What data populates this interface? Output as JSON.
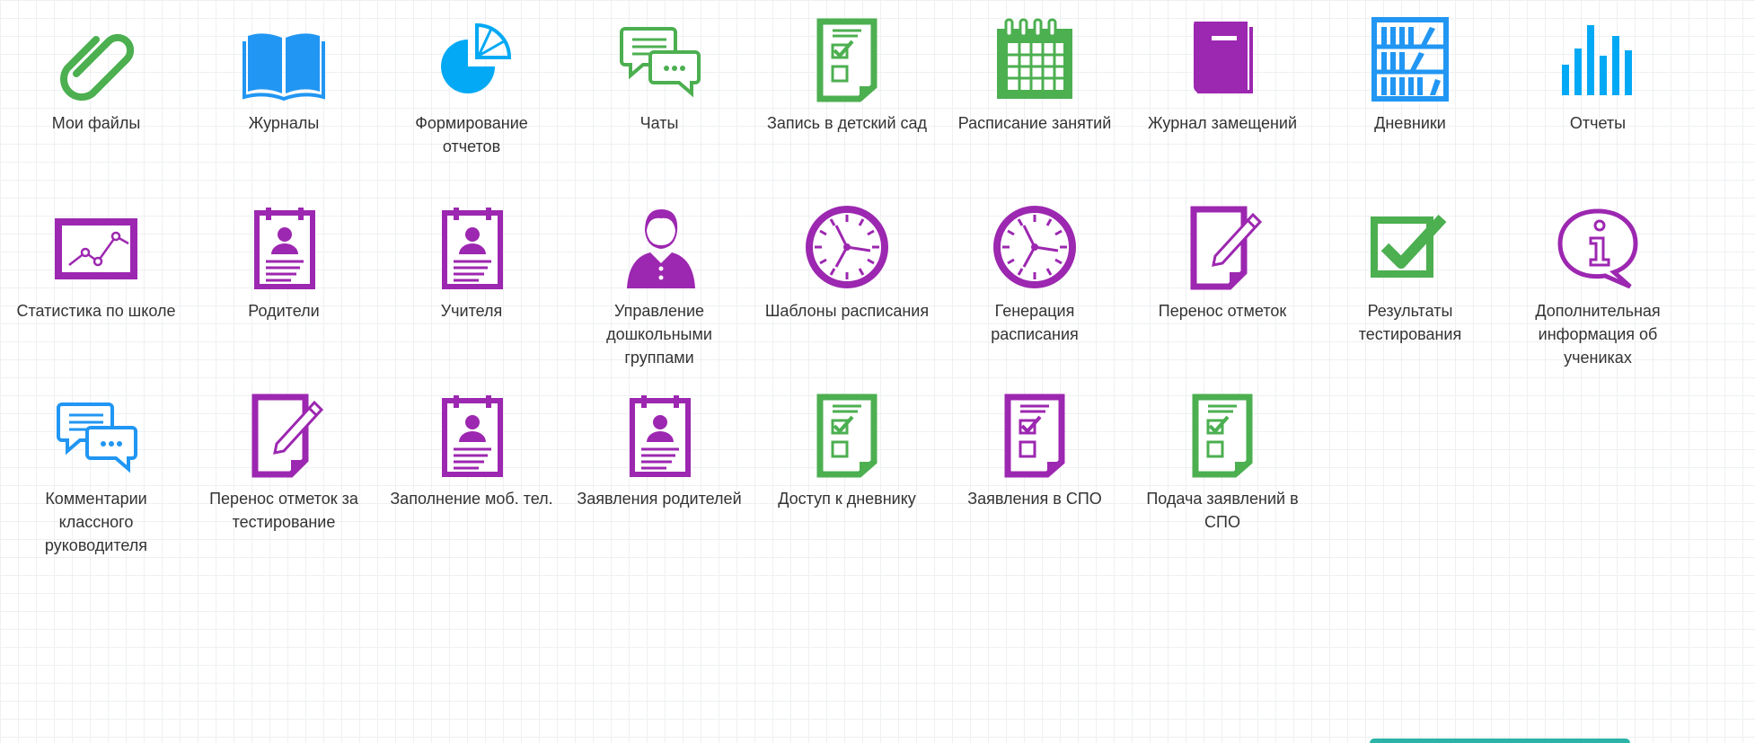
{
  "colors": {
    "green": "#4caf50",
    "blue": "#2196f3",
    "cyan": "#03a9f4",
    "purple": "#9c27b0",
    "label": "#333333"
  },
  "tiles": [
    {
      "id": "my-files",
      "label": "Мои файлы",
      "icon": "paperclip-icon",
      "color": "green"
    },
    {
      "id": "journals",
      "label": "Журналы",
      "icon": "open-book-icon",
      "color": "blue"
    },
    {
      "id": "reports-builder",
      "label": "Формирование отчетов",
      "icon": "pie-chart-icon",
      "color": "cyan"
    },
    {
      "id": "chats",
      "label": "Чаты",
      "icon": "chat-bubbles-icon",
      "color": "green"
    },
    {
      "id": "kindergarten-enrollment",
      "label": "Запись в детский сад",
      "icon": "checklist-document-icon",
      "color": "green"
    },
    {
      "id": "lesson-schedule",
      "label": "Расписание занятий",
      "icon": "calendar-icon",
      "color": "green"
    },
    {
      "id": "substitution-journal",
      "label": "Журнал замещений",
      "icon": "closed-book-icon",
      "color": "purple"
    },
    {
      "id": "diaries",
      "label": "Дневники",
      "icon": "bookshelf-icon",
      "color": "blue"
    },
    {
      "id": "reports",
      "label": "Отчеты",
      "icon": "bar-chart-icon",
      "color": "cyan"
    },
    {
      "id": "school-statistics",
      "label": "Статистика по школе",
      "icon": "line-chart-icon",
      "color": "purple"
    },
    {
      "id": "parents",
      "label": "Родители",
      "icon": "profile-card-icon",
      "color": "purple"
    },
    {
      "id": "teachers",
      "label": "Учителя",
      "icon": "profile-card-icon",
      "color": "purple"
    },
    {
      "id": "preschool-groups",
      "label": "Управление дошкольными группами",
      "icon": "user-icon",
      "color": "purple"
    },
    {
      "id": "schedule-templates",
      "label": "Шаблоны расписания",
      "icon": "clock-icon",
      "color": "purple"
    },
    {
      "id": "schedule-generation",
      "label": "Генерация расписания",
      "icon": "clock-icon",
      "color": "purple"
    },
    {
      "id": "grade-transfer",
      "label": "Перенос отметок",
      "icon": "document-pencil-icon",
      "color": "purple"
    },
    {
      "id": "test-results",
      "label": "Результаты тестирования",
      "icon": "checkbox-checked-icon",
      "color": "green"
    },
    {
      "id": "student-extra-info",
      "label": "Дополнительная информация об учениках",
      "icon": "info-bubble-icon",
      "color": "purple"
    },
    {
      "id": "class-teacher-comments",
      "label": "Комментарии классного руководителя",
      "icon": "chat-bubbles-icon",
      "color": "blue"
    },
    {
      "id": "test-grade-transfer",
      "label": "Перенос отметок за тестирование",
      "icon": "document-pencil-icon",
      "color": "purple"
    },
    {
      "id": "mobile-phone-entry",
      "label": "Заполнение моб. тел.",
      "icon": "profile-card-icon",
      "color": "purple"
    },
    {
      "id": "parent-applications",
      "label": "Заявления родителей",
      "icon": "profile-card-icon",
      "color": "purple"
    },
    {
      "id": "diary-access",
      "label": "Доступ к дневнику",
      "icon": "checklist-document-icon",
      "color": "green"
    },
    {
      "id": "spo-applications",
      "label": "Заявления в СПО",
      "icon": "checklist-document-icon",
      "color": "purple"
    },
    {
      "id": "spo-application-submit",
      "label": "Подача заявлений в СПО",
      "icon": "checklist-document-icon",
      "color": "green"
    }
  ]
}
